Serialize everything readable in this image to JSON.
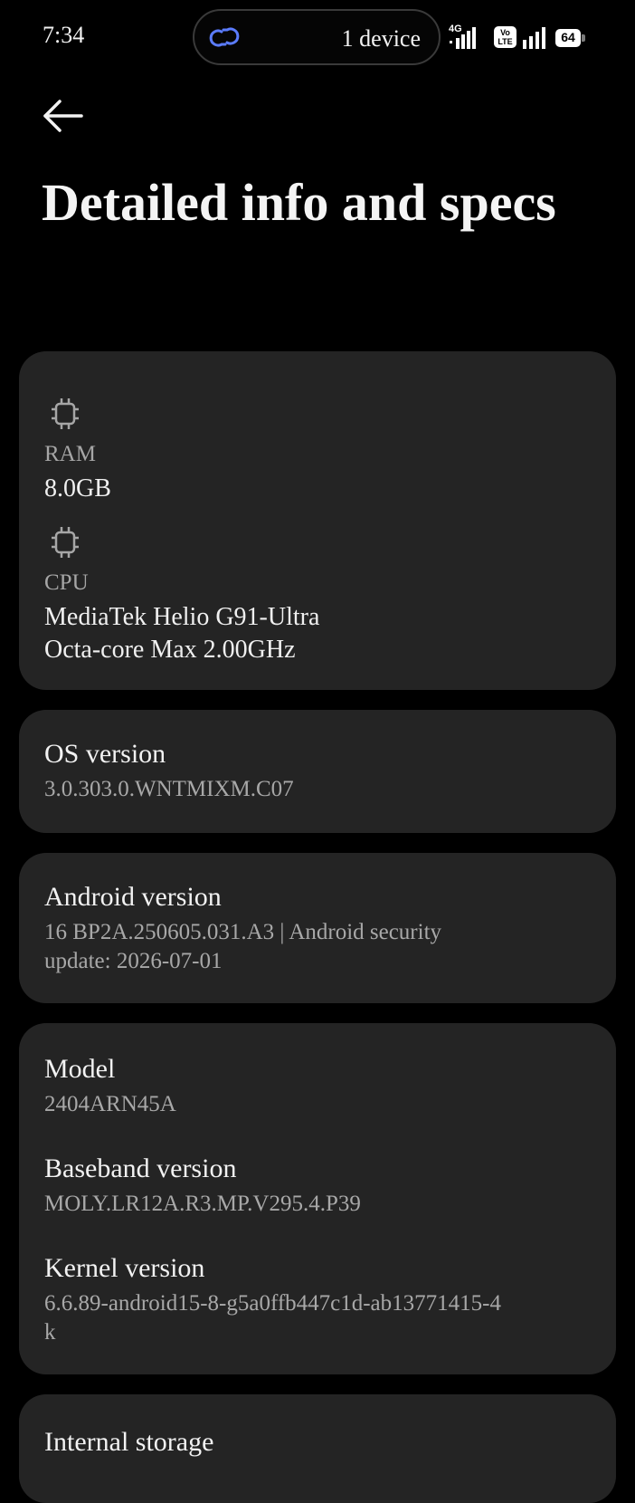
{
  "status_bar": {
    "time": "7:34",
    "connection_pill": {
      "icon": "link-icon",
      "label": "1 device"
    },
    "network_label": "4G",
    "volte_label_top": "Vo",
    "volte_label_bottom": "LTE",
    "battery_level": "64"
  },
  "header": {
    "back_icon": "arrow-left-icon",
    "title": "Detailed info and specs"
  },
  "hardware_card": {
    "ram": {
      "icon": "chip-icon",
      "label": "RAM",
      "value": "8.0GB"
    },
    "cpu": {
      "icon": "chip-icon",
      "label": "CPU",
      "value_line1": "MediaTek Helio G91-Ultra",
      "value_line2": "Octa-core Max 2.00GHz"
    }
  },
  "os_card": {
    "title": "OS version",
    "value": "3.0.303.0.WNTMIXM.C07"
  },
  "android_card": {
    "title": "Android version",
    "value_line1": "16 BP2A.250605.031.A3 | Android security",
    "value_line2": "update: 2026-07-01"
  },
  "model_card": {
    "model": {
      "title": "Model",
      "value": "2404ARN45A"
    },
    "baseband": {
      "title": "Baseband version",
      "value": "MOLY.LR12A.R3.MP.V295.4.P39"
    },
    "kernel": {
      "title": "Kernel version",
      "value_line1": "6.6.89-android15-8-g5a0ffb447c1d-ab13771415-4",
      "value_line2": "k"
    }
  },
  "storage_card": {
    "title": "Internal storage"
  },
  "colors": {
    "background": "#000000",
    "card": "#242424",
    "accent_link": "#5b7cff",
    "text_primary": "#f2f2f2",
    "text_secondary": "#a8a8a8"
  }
}
